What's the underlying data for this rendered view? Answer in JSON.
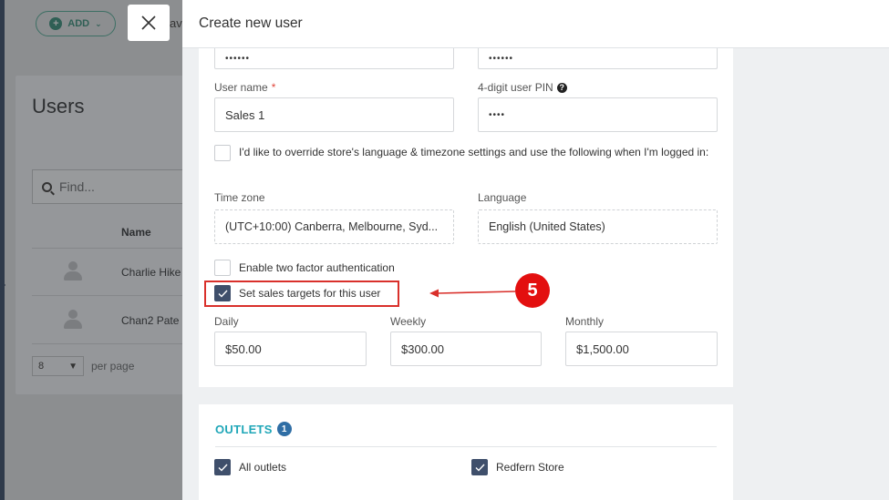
{
  "background": {
    "add_label": "ADD",
    "truncated_text": "av",
    "title": "Users",
    "search_placeholder": "Find...",
    "column_name": "Name",
    "rows": [
      {
        "name": "Charlie Hike"
      },
      {
        "name": "Chan2 Pate"
      }
    ],
    "per_page_value": "8",
    "per_page_label": "per page"
  },
  "panel": {
    "title": "Create new user",
    "password_mask": "••••••",
    "confirm_password_mask": "••••••",
    "username_label": "User name",
    "username_required": "*",
    "username_value": "Sales 1",
    "pin_label": "4-digit user PIN",
    "pin_value": "••••",
    "override_label": "I'd like to override store's language & timezone settings and use the following when I'm logged in:",
    "timezone_label": "Time zone",
    "timezone_value": "(UTC+10:00) Canberra, Melbourne, Syd...",
    "language_label": "Language",
    "language_value": "English (United States)",
    "two_factor_label": "Enable two factor authentication",
    "sales_targets_label": "Set sales targets for this user",
    "daily_label": "Daily",
    "daily_value": "$50.00",
    "weekly_label": "Weekly",
    "weekly_value": "$300.00",
    "monthly_label": "Monthly",
    "monthly_value": "$1,500.00"
  },
  "outlets": {
    "title": "OUTLETS",
    "count": "1",
    "all_outlets_label": "All outlets",
    "store_label": "Redfern Store"
  },
  "annotation": {
    "step": "5",
    "color": "#e30f0f"
  },
  "colors": {
    "accent_teal": "#20a7b8",
    "checkbox_checked": "#3f4f6b",
    "required": "#e0453b"
  }
}
